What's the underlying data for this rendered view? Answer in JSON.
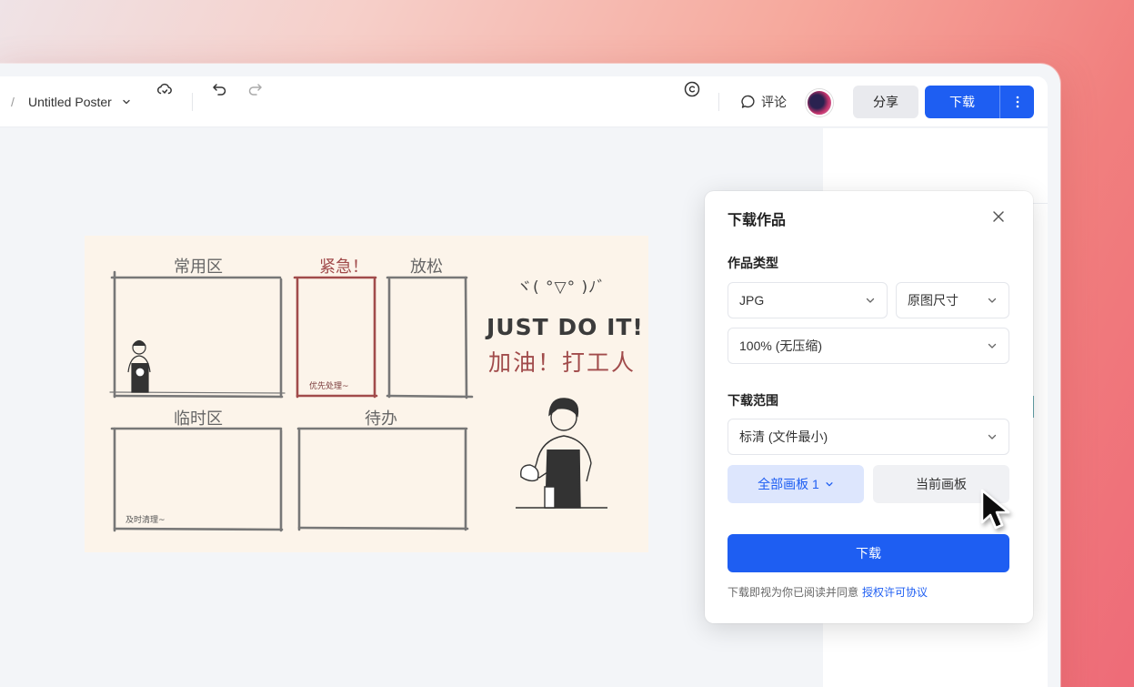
{
  "toolbar": {
    "breadcrumb_sep": "/",
    "doc_title": "Untitled Poster",
    "comment_label": "评论",
    "share_label": "分享",
    "download_label": "下载",
    "icons": [
      "chevron-down-icon",
      "cloud-sync-icon",
      "undo-icon",
      "redo-icon",
      "copyright-icon",
      "comment-icon",
      "more-vertical-icon"
    ]
  },
  "poster": {
    "zone_common": "常用区",
    "zone_urgent": "紧急！",
    "zone_relax": "放松",
    "zone_temp": "临时区",
    "zone_todo": "待办",
    "note_priority": "优先处理~",
    "note_clean": "及时清理~",
    "kaomoji": "ヾ( °▽° )ﾉ゛",
    "slogan_en": "JUST DO IT!",
    "slogan_cn": "加油！打工人"
  },
  "dialog": {
    "title": "下载作品",
    "type_label": "作品类型",
    "format_value": "JPG",
    "size_value": "原图尺寸",
    "quality_value": "100% (无压缩)",
    "range_label": "下载范围",
    "resolution_value": "标清 (文件最小)",
    "scope_all": "全部画板 1",
    "scope_current": "当前画板",
    "download_button": "下载",
    "footer_text": "下载即视为你已阅读并同意",
    "footer_link": "授权许可协议"
  },
  "colors": {
    "accent": "#1e5ef2",
    "accent_light": "#dde6fd",
    "poster_bg": "#fcf4ea",
    "urgent_red": "#a14b4b"
  }
}
